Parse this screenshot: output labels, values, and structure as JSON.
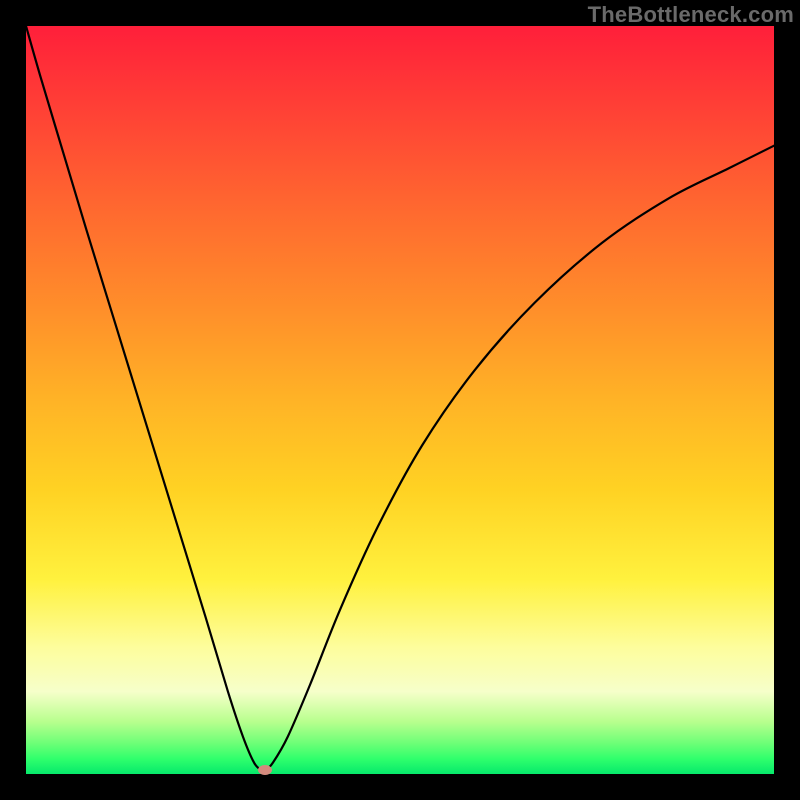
{
  "watermark": "TheBottleneck.com",
  "chart_data": {
    "type": "line",
    "title": "",
    "xlabel": "",
    "ylabel": "",
    "xlim": [
      0,
      100
    ],
    "ylim": [
      0,
      100
    ],
    "series": [
      {
        "name": "bottleneck-curve",
        "x": [
          0,
          2,
          5,
          8,
          12,
          16,
          20,
          24,
          27,
          29,
          30.5,
          31.5,
          32,
          33,
          35,
          38,
          42,
          47,
          53,
          60,
          68,
          77,
          86,
          94,
          100
        ],
        "y": [
          100,
          93,
          83,
          73,
          60,
          47,
          34,
          21,
          11,
          5,
          1.5,
          0.5,
          0.5,
          1.5,
          5,
          12,
          22,
          33,
          44,
          54,
          63,
          71,
          77,
          81,
          84
        ]
      }
    ],
    "marker": {
      "x": 32,
      "y": 0.5,
      "color": "#d48a7d"
    },
    "background_gradient": {
      "top": "#ff1f3a",
      "mid": "#ffd223",
      "bottom": "#06e96b"
    }
  }
}
